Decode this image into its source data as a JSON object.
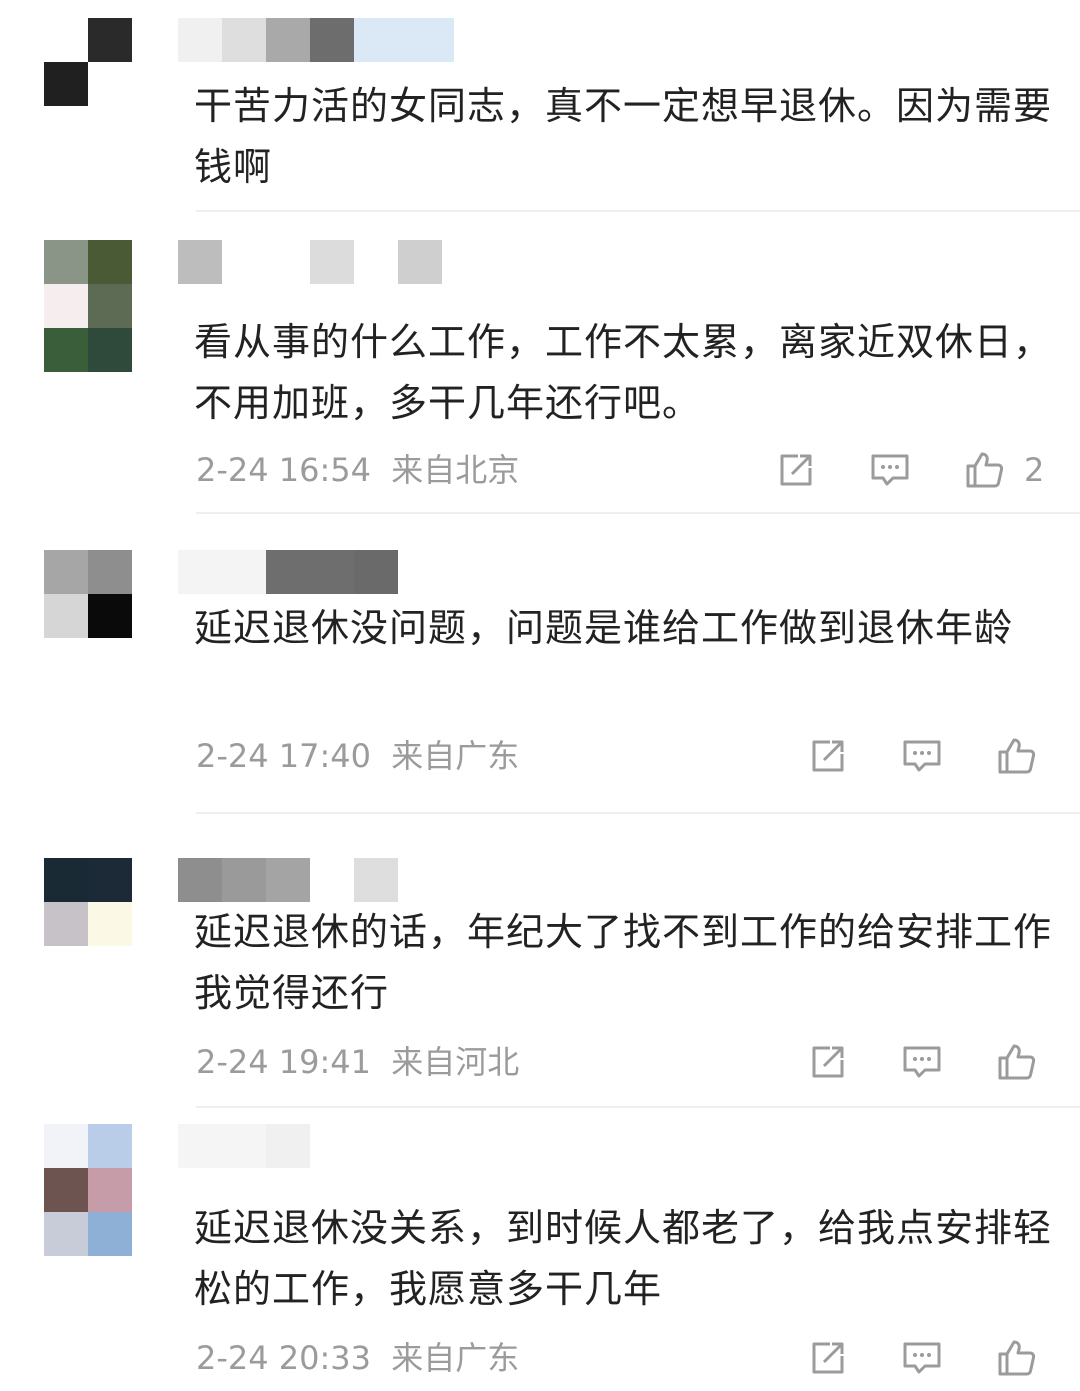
{
  "comments": [
    {
      "text": "干苦力活的女同志，真不一定想早退休。因为需要钱啊",
      "avatar_colors": [
        "#ffffff",
        "#2a2a2a",
        "#202020",
        "#ffffff"
      ],
      "name_colors": [
        "#f0f0f0",
        "#dedede",
        "#a9a9a9",
        "#6d6d6d",
        "#dbe8f6"
      ]
    },
    {
      "text": "看从事的什么工作，工作不太累，离家近双休日，不用加班，多干几年还行吧。",
      "timestamp": "2-24 16:54",
      "location": "来自北京",
      "likes": "2",
      "avatar_colors": [
        "#8a9587",
        "#4a5a34",
        "#f6eeee",
        "#5e6b54",
        "#3a5e3a",
        "#2f4a3a"
      ],
      "name_colors": [
        "#bdbdbd",
        "#ffffff",
        "#dcdcdc",
        "#ffffff",
        "#cfcfcf"
      ]
    },
    {
      "text": "延迟退休没问题，问题是谁给工作做到退休年龄",
      "timestamp": "2-24 17:40",
      "location": "来自广东",
      "likes": "",
      "avatar_colors": [
        "#a6a6a6",
        "#8e8e8e",
        "#d6d6d6",
        "#0a0a0a"
      ],
      "name_colors": [
        "#f4f4f4",
        "#6e6e6e",
        "#6a6a6a"
      ]
    },
    {
      "text": "延迟退休的话，年纪大了找不到工作的给安排工作我觉得还行",
      "timestamp": "2-24 19:41",
      "location": "来自河北",
      "likes": "",
      "avatar_colors": [
        "#1a2a35",
        "#1c2a38",
        "#c6c2c8",
        "#fbf8e6"
      ],
      "name_colors": [
        "#8e8e8e",
        "#9a9a9a",
        "#a4a4a4",
        "#ffffff",
        "#dedede"
      ]
    },
    {
      "text": "延迟退休没关系，到时候人都老了，给我点安排轻松的工作，我愿意多干几年",
      "timestamp": "2-24 20:33",
      "location": "来自广东",
      "likes": "",
      "avatar_colors": [
        "#f2f3f8",
        "#b9cde8",
        "#6e5450",
        "#c69ca8",
        "#c7ccd8",
        "#8fb0d6"
      ],
      "name_colors": [
        "#f5f5f5",
        "#f0f0f0"
      ]
    }
  ],
  "icons": {
    "share": "share-icon",
    "comment": "comment-icon",
    "like": "like-icon"
  },
  "colors": {
    "text": "#222222",
    "meta": "#9b9b9b",
    "icon": "#9b9b9b",
    "divider": "#eeeeee"
  }
}
